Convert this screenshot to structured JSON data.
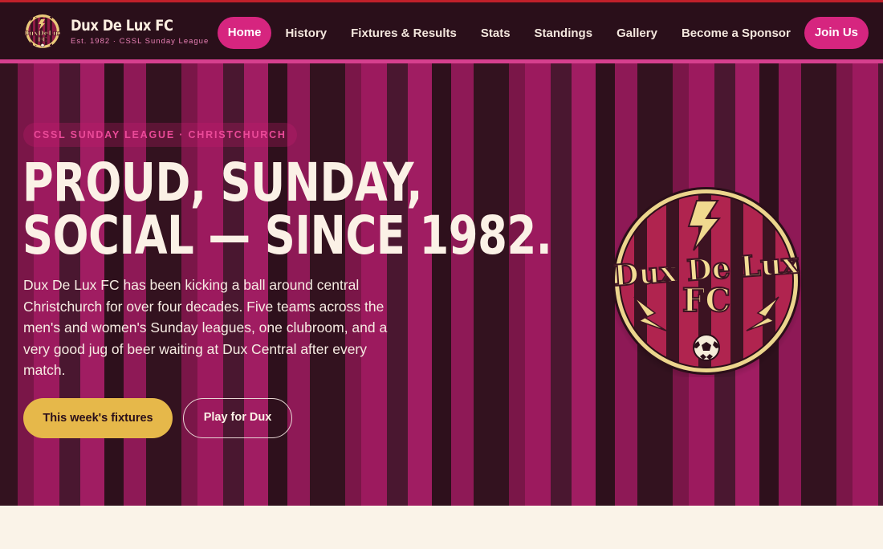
{
  "brand": {
    "name": "Dux De Lux FC",
    "tagline": "Est. 1982 · CSSL Sunday League"
  },
  "nav": {
    "items": [
      "Home",
      "History",
      "Fixtures & Results",
      "Stats",
      "Standings",
      "Gallery",
      "Become a Sponsor"
    ],
    "active": "Home",
    "cta": "Join Us"
  },
  "hero": {
    "eyebrow": "CSSL SUNDAY LEAGUE · CHRISTCHURCH",
    "headline_line1": "PROUD, SUNDAY,",
    "headline_line2": "SOCIAL — SINCE 1982.",
    "intro": "Dux De Lux FC has been kicking a ball around central Christchurch for over four decades. Five teams across the men's and women's Sunday leagues, one clubroom, and a very good jug of beer waiting at Dux Central after every match.",
    "primary_button": "This week's fixtures",
    "secondary_button": "Play for Dux"
  },
  "crest": {
    "line1": "Dux De Lux",
    "line2": "FC"
  },
  "colors": {
    "header_bg": "#2a0f1a",
    "accent_pink": "#d6257f",
    "stripe_magenta": "#9c1a5e",
    "stripe_dark": "#33121f",
    "gold": "#e6b84a",
    "cream": "#faf3e8"
  },
  "icons": {
    "crest": "club-crest-icon",
    "lightning": "lightning-bolt-icon",
    "ball": "football-icon"
  }
}
